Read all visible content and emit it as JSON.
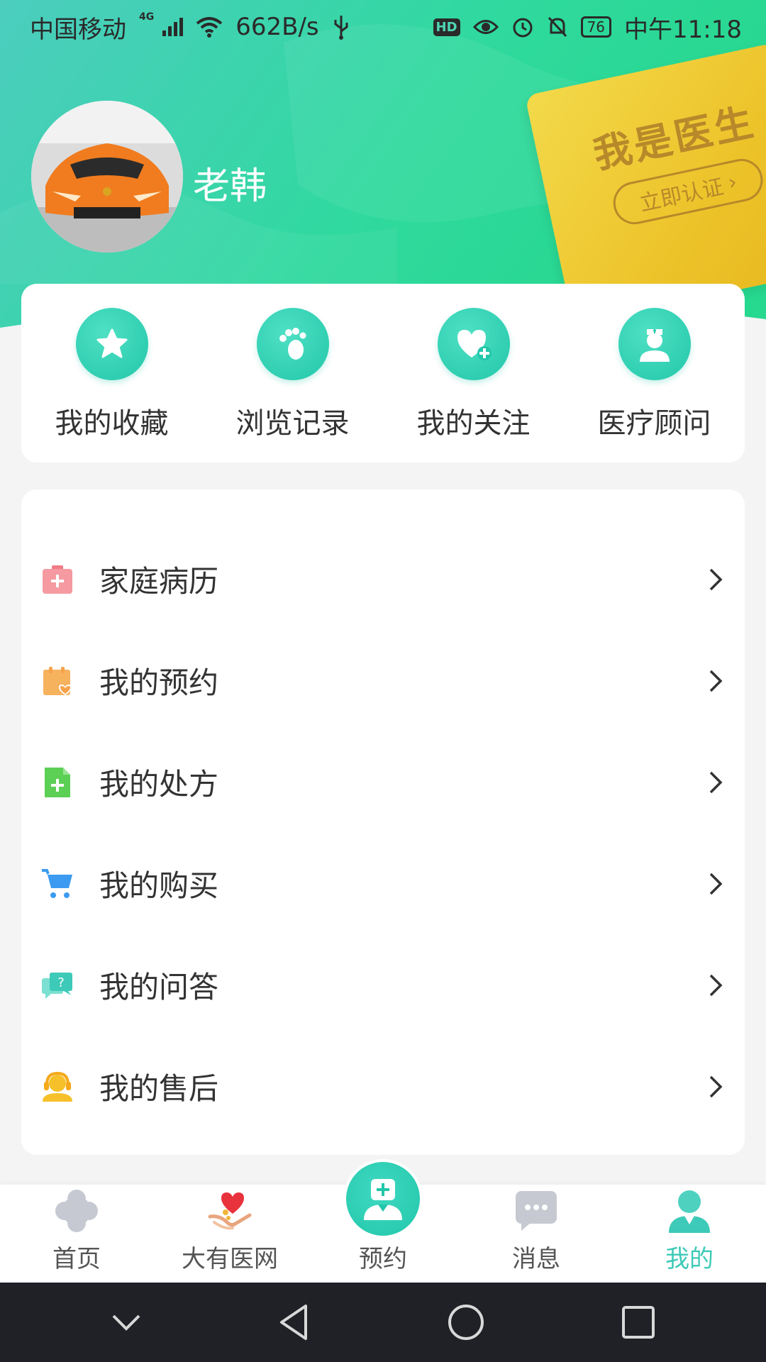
{
  "statusbar": {
    "carrier": "中国移动",
    "network": "4G",
    "speed": "662B/s",
    "hd": "HD",
    "battery": "76",
    "time": "中午11:18"
  },
  "profile": {
    "name": "老韩"
  },
  "doctor_card": {
    "title": "我是医生",
    "button": "立即认证"
  },
  "quick_actions": [
    {
      "label": "我的收藏",
      "icon": "star-icon"
    },
    {
      "label": "浏览记录",
      "icon": "footprint-icon"
    },
    {
      "label": "我的关注",
      "icon": "heart-plus-icon"
    },
    {
      "label": "医疗顾问",
      "icon": "nurse-icon"
    }
  ],
  "menu": [
    {
      "label": "家庭病历",
      "icon": "medical-record-icon",
      "color": "#f27c84"
    },
    {
      "label": "我的预约",
      "icon": "calendar-heart-icon",
      "color": "#f7a24a"
    },
    {
      "label": "我的处方",
      "icon": "prescription-icon",
      "color": "#5ccf55"
    },
    {
      "label": "我的购买",
      "icon": "cart-icon",
      "color": "#3c9bf0"
    },
    {
      "label": "我的问答",
      "icon": "qa-icon",
      "color": "#3ecab8"
    },
    {
      "label": "我的售后",
      "icon": "service-icon",
      "color": "#f5c02a"
    }
  ],
  "bottom_nav": [
    {
      "label": "首页",
      "icon": "home-cross-icon"
    },
    {
      "label": "大有医网",
      "icon": "heart-hands-icon"
    },
    {
      "label": "预约",
      "icon": "doctor-icon"
    },
    {
      "label": "消息",
      "icon": "message-icon"
    },
    {
      "label": "我的",
      "icon": "user-icon",
      "active": true
    }
  ],
  "colors": {
    "accent": "#3ecab8",
    "header_start": "#46d1b7",
    "header_end": "#2ed89a",
    "card_gold": "#edc32a"
  }
}
